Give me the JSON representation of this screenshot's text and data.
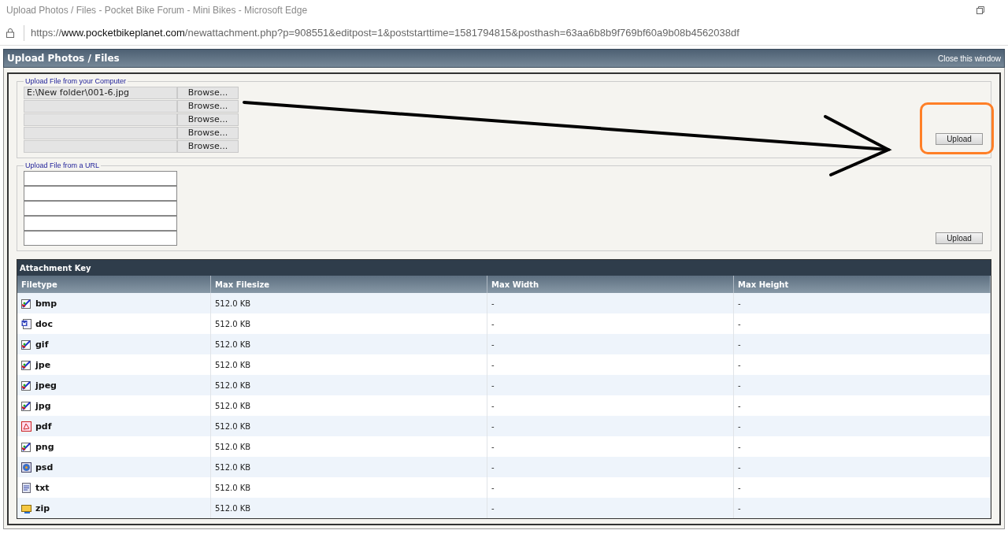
{
  "browser": {
    "title": "Upload Photos / Files - Pocket Bike Forum - Mini Bikes - Microsoft Edge",
    "url_scheme": "https://",
    "url_host": "www.pocketbikeplanet.com",
    "url_path": "/newattachment.php?p=908551&editpost=1&poststarttime=1581794815&posthash=63aa6b8b9f769bf60a9b08b4562038df"
  },
  "header": {
    "title": "Upload Photos / Files",
    "close_link": "Close this window"
  },
  "computer_upload": {
    "legend": "Upload File from your Computer",
    "upload_button": "Upload",
    "highlighted": true,
    "arrow": true,
    "files": [
      {
        "value": "E:\\New folder\\001-6.jpg",
        "button": "Browse..."
      },
      {
        "button": "Browse..."
      },
      {
        "button": "Browse..."
      },
      {
        "button": "Browse..."
      },
      {
        "button": "Browse..."
      }
    ]
  },
  "url_upload": {
    "legend": "Upload File from a URL",
    "upload_button": "Upload"
  },
  "attachment_key": {
    "title": "Attachment Key",
    "columns": [
      "Filetype",
      "Max Filesize",
      "Max Width",
      "Max Height"
    ],
    "rows": [
      {
        "kind": "image",
        "type": "bmp",
        "size": "512.0 KB",
        "width": "-",
        "height": "-"
      },
      {
        "kind": "word",
        "type": "doc",
        "size": "512.0 KB",
        "width": "-",
        "height": "-"
      },
      {
        "kind": "image",
        "type": "gif",
        "size": "512.0 KB",
        "width": "-",
        "height": "-"
      },
      {
        "kind": "image",
        "type": "jpe",
        "size": "512.0 KB",
        "width": "-",
        "height": "-"
      },
      {
        "kind": "image",
        "type": "jpeg",
        "size": "512.0 KB",
        "width": "-",
        "height": "-"
      },
      {
        "kind": "image",
        "type": "jpg",
        "size": "512.0 KB",
        "width": "-",
        "height": "-"
      },
      {
        "kind": "pdf",
        "type": "pdf",
        "size": "512.0 KB",
        "width": "-",
        "height": "-"
      },
      {
        "kind": "image",
        "type": "png",
        "size": "512.0 KB",
        "width": "-",
        "height": "-"
      },
      {
        "kind": "psd",
        "type": "psd",
        "size": "512.0 KB",
        "width": "-",
        "height": "-"
      },
      {
        "kind": "text",
        "type": "txt",
        "size": "512.0 KB",
        "width": "-",
        "height": "-"
      },
      {
        "kind": "zip",
        "type": "zip",
        "size": "512.0 KB",
        "width": "-",
        "height": "-"
      }
    ]
  }
}
